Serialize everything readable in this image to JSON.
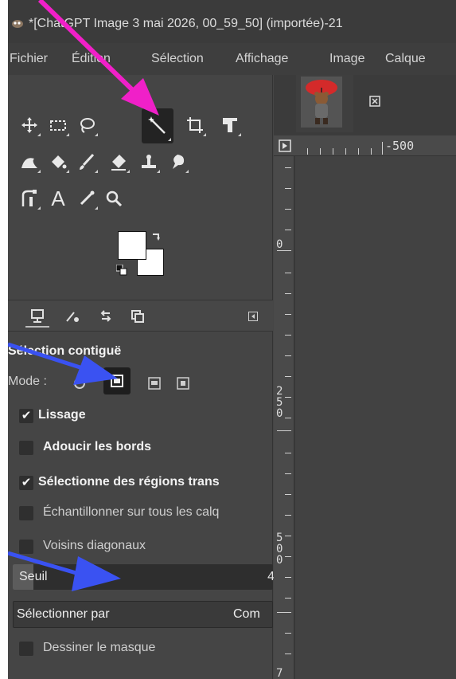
{
  "window": {
    "title": "*[ChatGPT Image 3 mai 2026, 00_59_50] (importée)-21"
  },
  "menu": [
    "Fichier",
    "Édition",
    "Sélection",
    "Affichage",
    "Image",
    "Calque"
  ],
  "toolbox": {
    "tools": [
      {
        "name": "move-tool",
        "icon": "move-icon",
        "glyph": "✥"
      },
      {
        "name": "rect-select-tool",
        "icon": "rect-select-icon",
        "glyph": "▭"
      },
      {
        "name": "free-select-tool",
        "icon": "lasso-icon",
        "glyph": "ʘ"
      },
      {
        "name": "fuzzy-select-tool",
        "icon": "magic-wand-icon",
        "glyph": "⚡"
      },
      {
        "name": "crop-tool",
        "icon": "crop-icon",
        "glyph": "⌗"
      },
      {
        "name": "unified-transform-tool",
        "icon": "transform-icon",
        "glyph": "⤱"
      },
      {
        "name": "warp-tool",
        "icon": "warp-icon",
        "glyph": "◣"
      },
      {
        "name": "bucket-fill-tool",
        "icon": "bucket-icon",
        "glyph": "⬙"
      },
      {
        "name": "paintbrush-tool",
        "icon": "brush-icon",
        "glyph": "⁄"
      },
      {
        "name": "eraser-tool",
        "icon": "eraser-icon",
        "glyph": "⌫"
      },
      {
        "name": "clone-tool",
        "icon": "clone-icon",
        "glyph": "⊥"
      },
      {
        "name": "smudge-tool",
        "icon": "smudge-icon",
        "glyph": "ↄ"
      },
      {
        "name": "paths-tool",
        "icon": "paths-icon",
        "glyph": "⌐"
      },
      {
        "name": "text-tool",
        "icon": "text-icon",
        "glyph": "A"
      },
      {
        "name": "color-picker-tool",
        "icon": "color-picker-icon",
        "glyph": "⁄"
      },
      {
        "name": "zoom-tool",
        "icon": "zoom-icon",
        "glyph": "⌕"
      }
    ],
    "fg_color": "#ffffff",
    "bg_color": "#ffffff"
  },
  "dock_tabs": [
    "tool-options-tab",
    "device-status-tab",
    "undo-history-tab",
    "images-tab"
  ],
  "tool_options": {
    "heading": "Sélection contiguë",
    "mode_label": "Mode :",
    "lissage": {
      "label": "Lissage",
      "checked": true
    },
    "adoucir": {
      "label": "Adoucir les bords",
      "checked": false
    },
    "transparent": {
      "label": "Sélectionne des régions trans",
      "checked": true
    },
    "sample_merged": {
      "label": "Échantillonner sur tous les calq",
      "checked": false
    },
    "diagonal": {
      "label": "Voisins diagonaux",
      "checked": false
    },
    "threshold": {
      "label": "Seuil",
      "value_partial": "4"
    },
    "select_by": {
      "label": "Sélectionner par",
      "value": "Com"
    },
    "draw_mask": {
      "label": "Dessiner le masque",
      "checked": false
    }
  },
  "ruler": {
    "h_label": "-500",
    "v_labels": [
      {
        "text": "0"
      },
      {
        "text": "2\n5\n0"
      },
      {
        "text": "5\n0\n0"
      },
      {
        "text": "7"
      }
    ]
  },
  "colors": {
    "annotation_arrow_pink": "#f020c8",
    "annotation_arrow_blue": "#3a52f2"
  }
}
